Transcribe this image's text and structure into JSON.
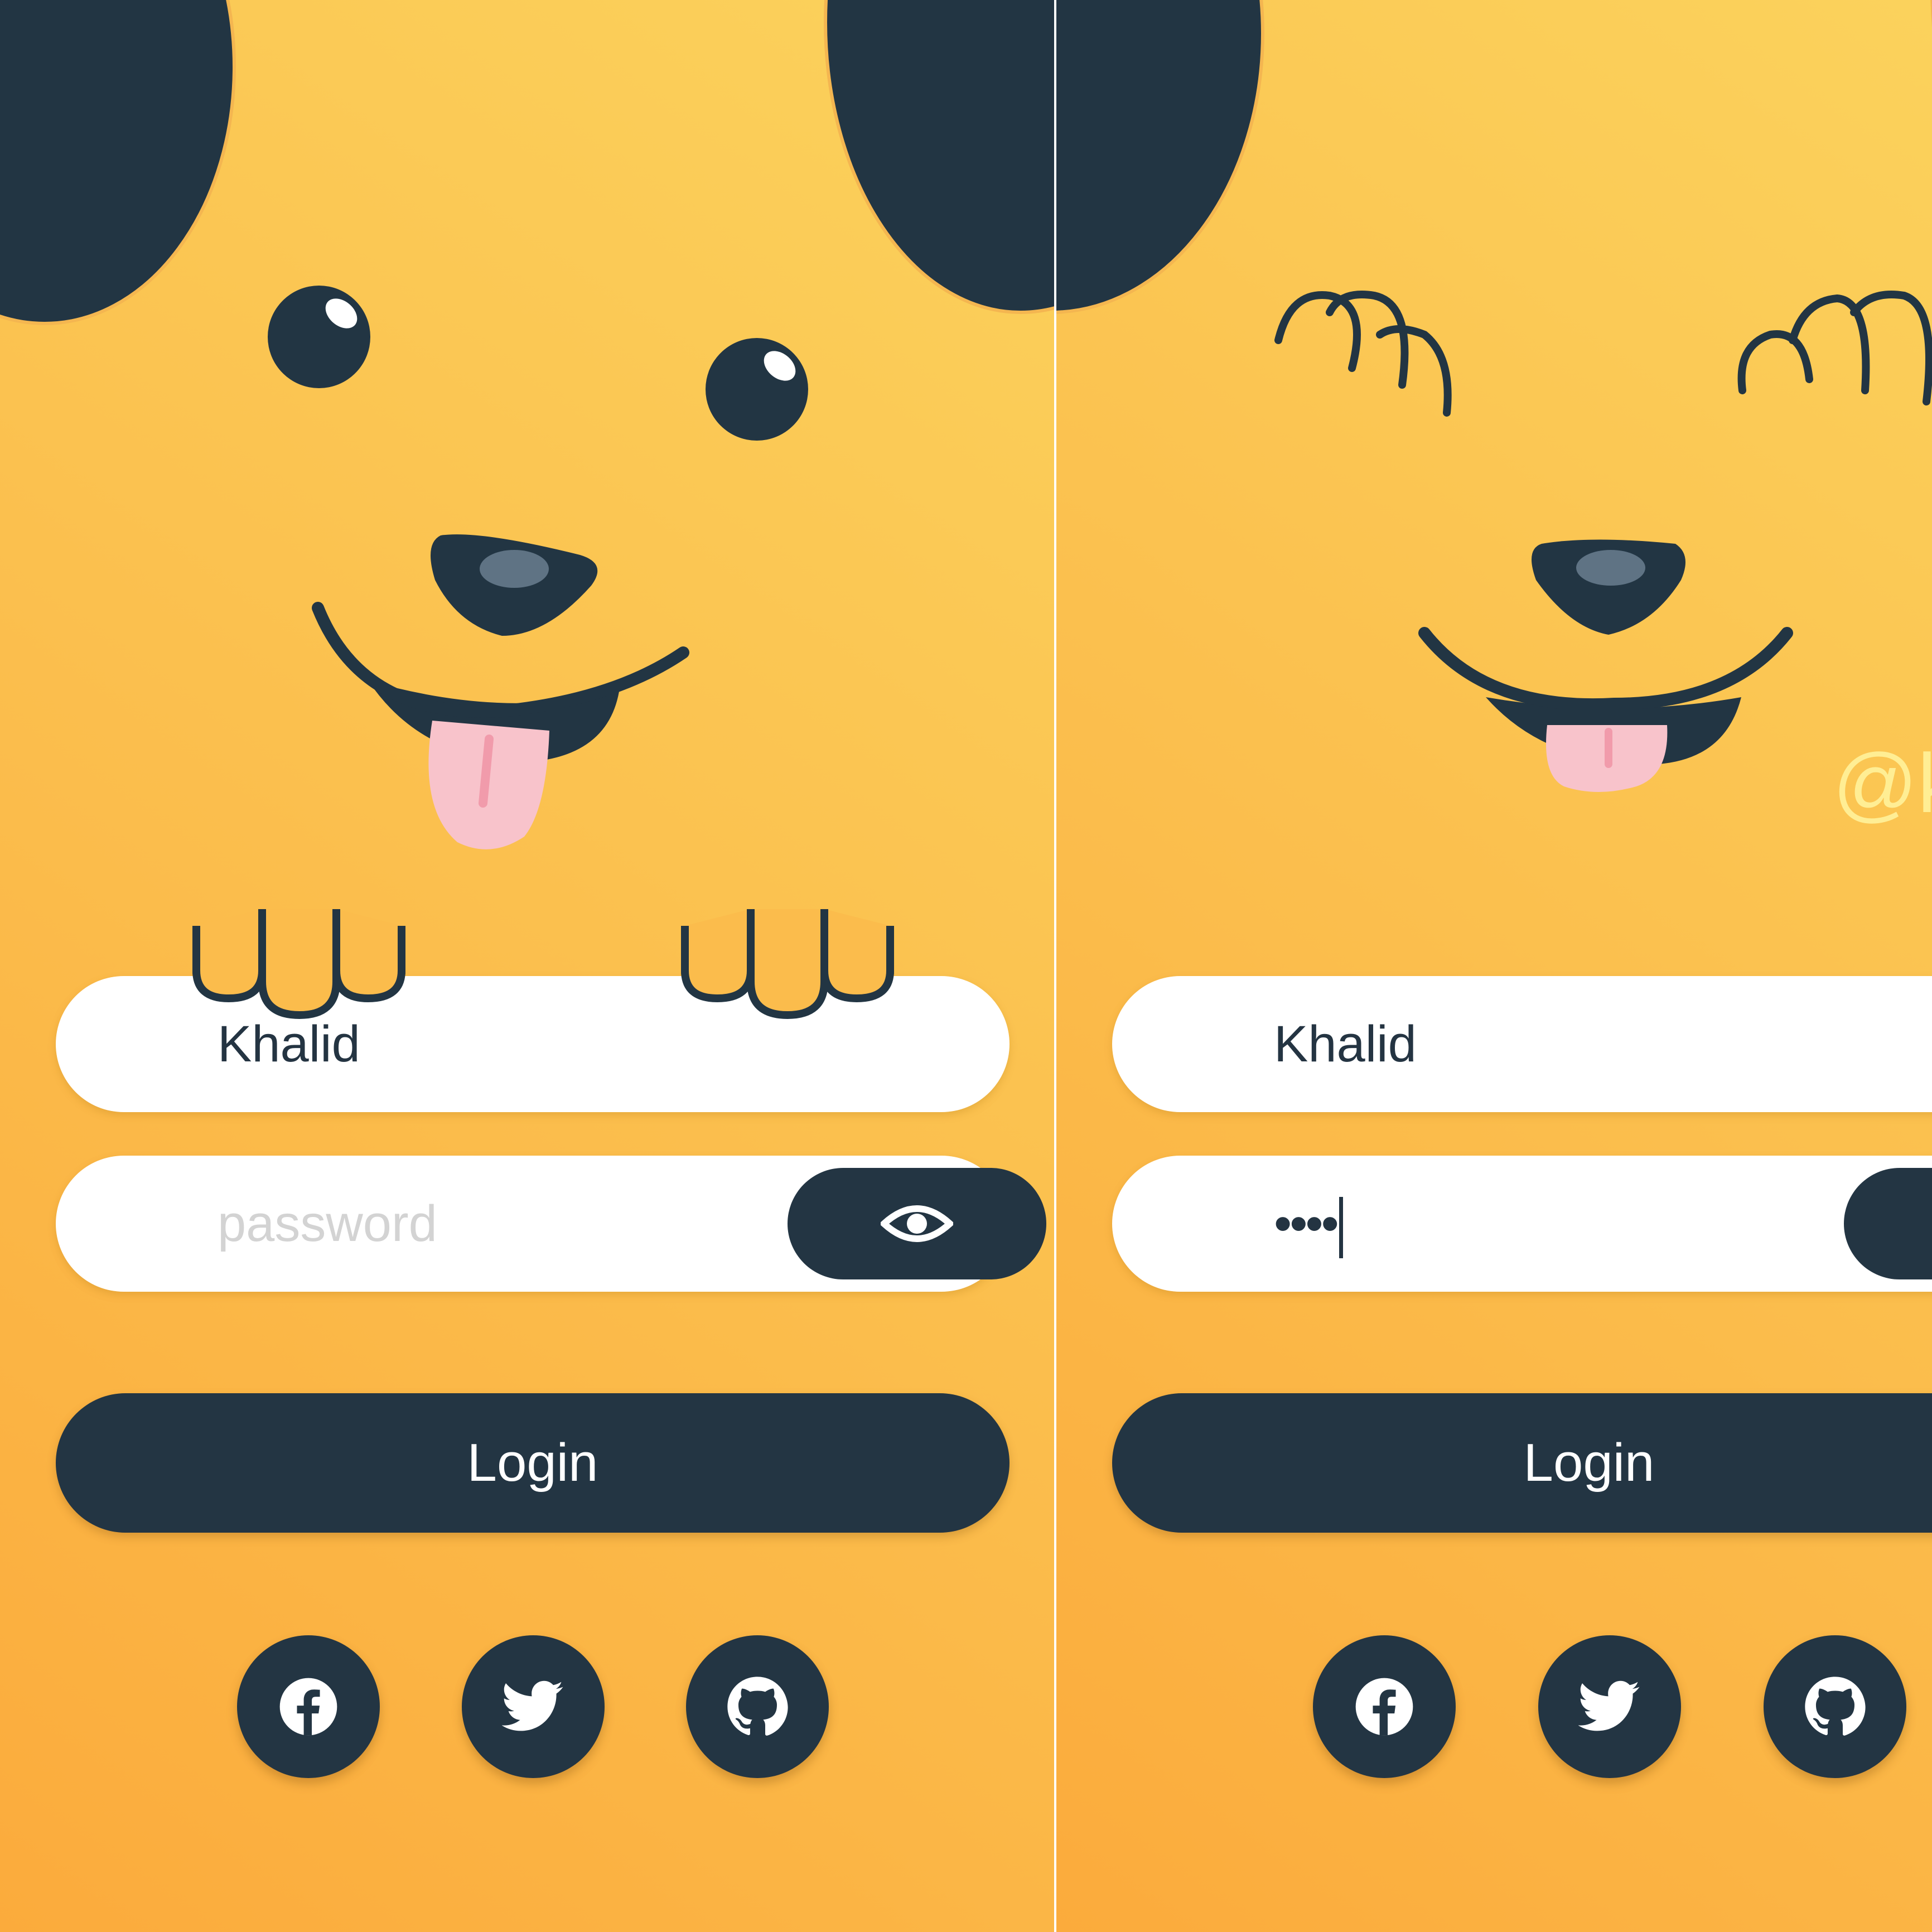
{
  "screens": [
    {
      "username_value": "Khalid",
      "password_placeholder": "password",
      "login_label": "Login",
      "eye_icon": "eye-icon",
      "social": [
        "facebook-icon",
        "twitter-icon",
        "github-icon"
      ]
    },
    {
      "username_value": "Khalid",
      "password_masked": "••••",
      "login_label": "Login",
      "social": [
        "facebook-icon",
        "twitter-icon",
        "github-icon"
      ],
      "watermark": "@k"
    }
  ],
  "colors": {
    "dark_navy": "#233543",
    "background_orange": "#fbab3c",
    "background_yellow": "#fbd25c",
    "tongue_pink": "#f8c0c8",
    "field_white": "#ffffff",
    "placeholder_gray": "#d3d3d3"
  }
}
